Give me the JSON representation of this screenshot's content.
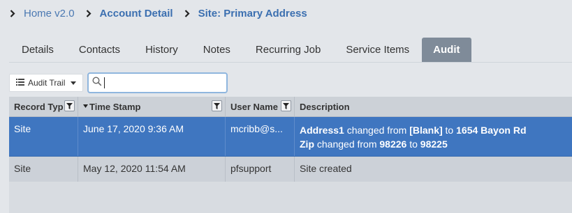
{
  "breadcrumb": [
    {
      "label": "Home v2.0"
    },
    {
      "label": "Account Detail"
    },
    {
      "label": "Site: Primary Address"
    }
  ],
  "tabs": [
    {
      "label": "Details"
    },
    {
      "label": "Contacts"
    },
    {
      "label": "History"
    },
    {
      "label": "Notes"
    },
    {
      "label": "Recurring Job"
    },
    {
      "label": "Service Items"
    },
    {
      "label": "Audit",
      "active": true
    }
  ],
  "toolbar": {
    "view_dropdown_label": "Audit Trail",
    "search_value": "",
    "search_placeholder": ""
  },
  "grid": {
    "columns": [
      "Record Typ",
      "Time Stamp",
      "User Name",
      "Description"
    ],
    "rows": [
      {
        "record_type": "Site",
        "time_stamp": "June 17, 2020 9:36 AM",
        "user_name": "mcribb@s...",
        "selected": true,
        "description_lines": [
          {
            "field": "Address1",
            "text1": " changed from ",
            "from": "[Blank]",
            "text2": " to ",
            "to": "1654 Bayon Rd"
          },
          {
            "field": "Zip",
            "text1": " changed from ",
            "from": "98226",
            "text2": " to ",
            "to": "98225"
          }
        ]
      },
      {
        "record_type": "Site",
        "time_stamp": "May 12, 2020 11:54 AM",
        "user_name": "pfsupport",
        "selected": false,
        "description": "Site created"
      }
    ]
  },
  "colors": {
    "background": "#e3e6ea",
    "active_tab": "#7f8b99",
    "selected_row": "#3f76c0",
    "link": "#3b6fb0"
  }
}
